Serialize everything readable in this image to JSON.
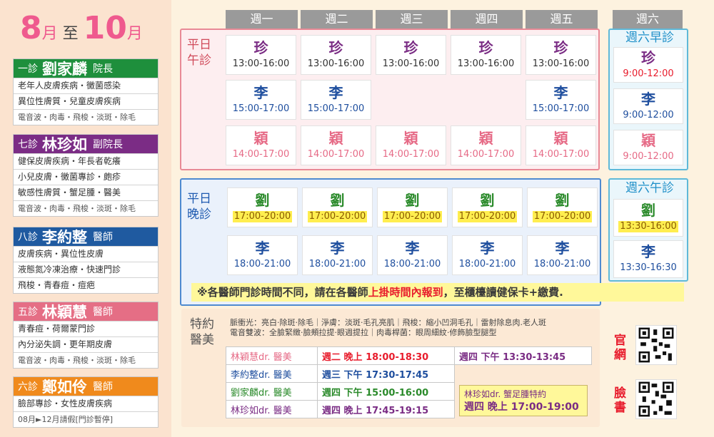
{
  "title": {
    "m1": "8",
    "u1": "月",
    "sep": " 至 ",
    "m2": "10",
    "u2": "月"
  },
  "doctors": [
    {
      "room": "一診",
      "name": "劉家麟",
      "rank": "院長",
      "color": "#1e8f3c",
      "lines": [
        "老年人皮膚疾病・黴菌感染",
        "異位性膚質・兒童皮膚疾病",
        "電音波・肉毒・飛梭・淡斑・除毛"
      ]
    },
    {
      "room": "七診",
      "name": "林珍如",
      "rank": "副院長",
      "color": "#7b2c85",
      "lines": [
        "健保皮膚疾病・年長者乾癢",
        "小兒皮膚・黴菌專診・皰疹",
        "敏感性膚質・蟹足腫・醫美",
        "電音波・肉毒・飛梭・淡斑・除毛"
      ]
    },
    {
      "room": "八診",
      "name": "李約整",
      "rank": "醫師",
      "color": "#1f5aa0",
      "lines": [
        "皮膚疾病・異位性皮膚",
        "液態氮冷凍治療・快速門診",
        "飛梭・青春痘・痘疤"
      ]
    },
    {
      "room": "五診",
      "name": "林穎慧",
      "rank": "醫師",
      "color": "#e56e85",
      "lines": [
        "青春痘・荷爾蒙門診",
        "內分泌失調・更年期皮膚",
        "電音波・肉毒・飛梭・淡斑・除毛"
      ]
    },
    {
      "room": "六診",
      "name": "鄭如伶",
      "rank": "醫師",
      "color": "#f08a1c",
      "lines": [
        "臉部專診・女性皮膚疾病",
        "08月►12月請假[門診暫停]"
      ]
    }
  ],
  "days": [
    "週一",
    "週二",
    "週三",
    "週四",
    "週五",
    "週六"
  ],
  "sessions": {
    "weekday_afternoon": "平日\n午診",
    "weekday_evening": "平日\n晚診",
    "sat_morning": "週六早診",
    "sat_afternoon": "週六午診",
    "special": "特約\n醫美"
  },
  "afternoon": {
    "zhen": {
      "doc": "珍",
      "time": "13:00-16:00"
    },
    "li": {
      "doc": "李",
      "time": "15:00-17:00"
    },
    "ying": {
      "doc": "穎",
      "time": "14:00-17:00"
    }
  },
  "evening": {
    "liu": {
      "doc": "劉",
      "time": "17:00-20:00"
    },
    "li": {
      "doc": "李",
      "time": "18:00-21:00"
    }
  },
  "saturday": {
    "zhen": {
      "doc": "珍",
      "time": "9:00-12:00"
    },
    "li": {
      "doc": "李",
      "time": "9:00-12:00"
    },
    "ying": {
      "doc": "穎",
      "time": "9:00-12:00"
    },
    "liu_pm": {
      "doc": "劉",
      "time": "13:30-16:00"
    },
    "li_pm": {
      "doc": "李",
      "time": "13:30-16:30"
    }
  },
  "note": {
    "a": "※各醫師門診時間不同，請在各醫師",
    "b": "上掛時間內報到",
    "c": "，至櫃檯讀健保卡+繳費."
  },
  "special": {
    "desc1": "脈衝光：亮白‧除斑‧除毛｜淨膚：淡斑‧毛孔亮肌｜飛梭：縮小凹洞毛孔｜雷射除息肉.老人斑",
    "desc2": "電音雙波：全臉緊緻‧臉頰拉提‧眼週提拉｜肉毒桿菌：眼周細紋‧修飾臉型腿型",
    "rows": [
      {
        "name": "林穎慧dr. 醫美",
        "slot": "週二 晚上",
        "time": "18:00-18:30"
      },
      {
        "name": "李約整dr. 醫美",
        "slot": "週三 下午",
        "time": "17:30-17:45"
      },
      {
        "name": "劉家麟dr. 醫美",
        "slot": "週四 下午",
        "time": "15:00-16:00"
      },
      {
        "name": "林珍如dr. 醫美",
        "slot": "週四 晚上",
        "time": "17:45-19:15"
      }
    ],
    "extra1": {
      "slot": "週四 下午",
      "time": "13:30-13:45"
    },
    "extra2": {
      "title": "林珍如dr. 蟹足腫特約",
      "slot": "週四 晚上",
      "time": "17:00-19:00"
    }
  },
  "side": {
    "official": "官網",
    "facebook": "臉書"
  },
  "colors": {
    "red": "#e81c2c",
    "pink": "#e66a86",
    "blue": "#1e4e9e",
    "purple": "#7a2c84"
  }
}
